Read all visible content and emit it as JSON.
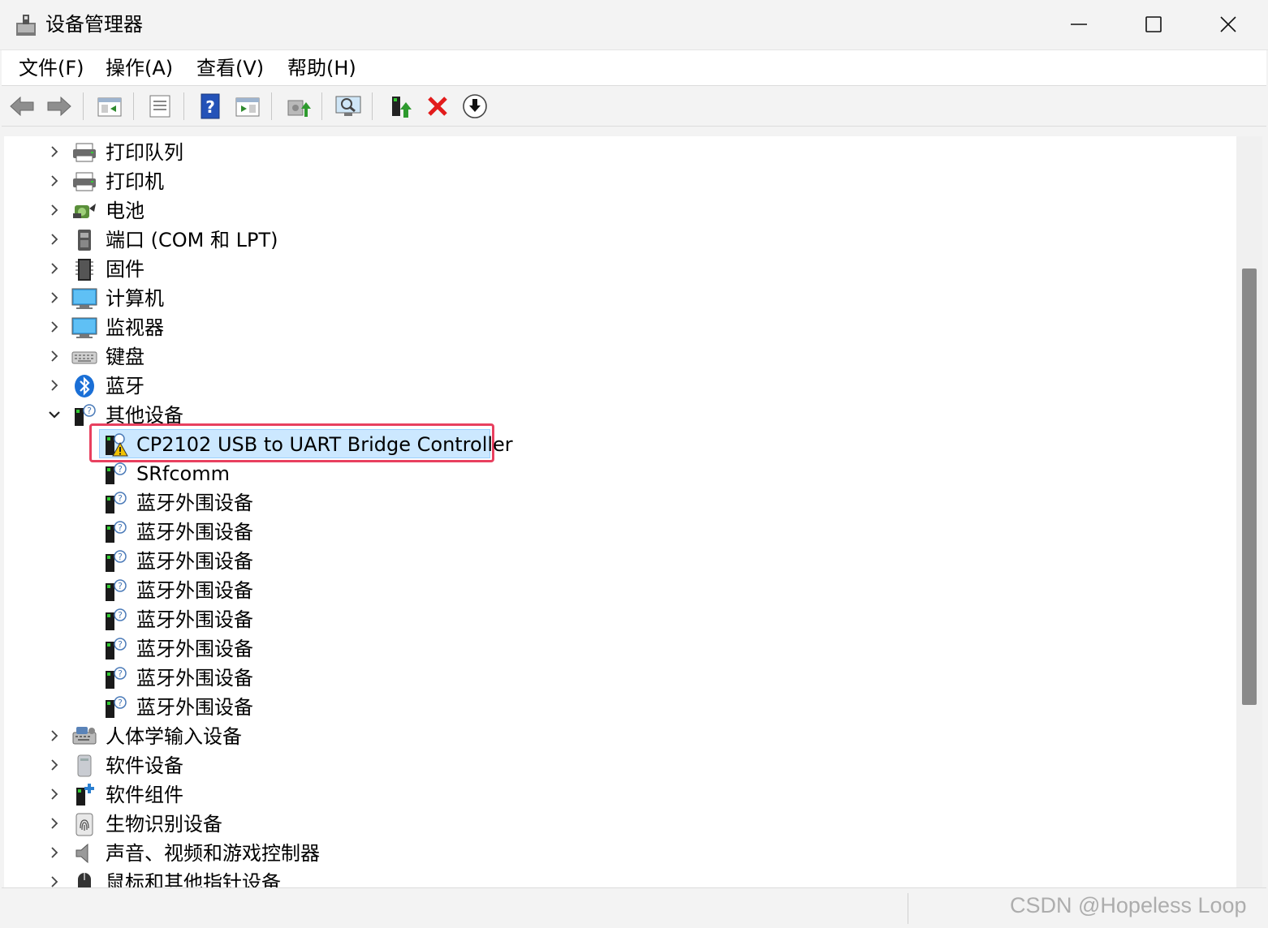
{
  "window": {
    "title": "设备管理器"
  },
  "menu": [
    "文件(F)",
    "操作(A)",
    "查看(V)",
    "帮助(H)"
  ],
  "toolbar": [
    "back",
    "forward",
    "show-hide-console-tree",
    "properties",
    "help",
    "action-pane",
    "update-driver",
    "scan-hardware",
    "enable-device",
    "uninstall-device",
    "download"
  ],
  "tree": {
    "categories_top": [
      {
        "label": "打印队列",
        "icon": "printer-queue-icon"
      },
      {
        "label": "打印机",
        "icon": "printer-icon"
      },
      {
        "label": "电池",
        "icon": "battery-icon"
      },
      {
        "label": "端口 (COM 和 LPT)",
        "icon": "port-icon"
      },
      {
        "label": "固件",
        "icon": "firmware-chip-icon"
      },
      {
        "label": "计算机",
        "icon": "computer-icon"
      },
      {
        "label": "监视器",
        "icon": "monitor-icon"
      },
      {
        "label": "键盘",
        "icon": "keyboard-icon"
      },
      {
        "label": "蓝牙",
        "icon": "bluetooth-icon"
      }
    ],
    "expanded": {
      "label": "其他设备",
      "icon": "unknown-device-icon",
      "children": [
        {
          "label": "CP2102 USB to UART Bridge Controller",
          "icon": "warning-device-icon",
          "selected": true,
          "highlighted": true
        },
        {
          "label": "SRfcomm",
          "icon": "unknown-device-icon"
        },
        {
          "label": "蓝牙外围设备",
          "icon": "unknown-device-icon"
        },
        {
          "label": "蓝牙外围设备",
          "icon": "unknown-device-icon"
        },
        {
          "label": "蓝牙外围设备",
          "icon": "unknown-device-icon"
        },
        {
          "label": "蓝牙外围设备",
          "icon": "unknown-device-icon"
        },
        {
          "label": "蓝牙外围设备",
          "icon": "unknown-device-icon"
        },
        {
          "label": "蓝牙外围设备",
          "icon": "unknown-device-icon"
        },
        {
          "label": "蓝牙外围设备",
          "icon": "unknown-device-icon"
        },
        {
          "label": "蓝牙外围设备",
          "icon": "unknown-device-icon"
        }
      ]
    },
    "categories_bottom": [
      {
        "label": "人体学输入设备",
        "icon": "hid-icon"
      },
      {
        "label": "软件设备",
        "icon": "software-device-icon"
      },
      {
        "label": "软件组件",
        "icon": "software-component-icon"
      },
      {
        "label": "生物识别设备",
        "icon": "biometric-icon"
      },
      {
        "label": "声音、视频和游戏控制器",
        "icon": "speaker-icon"
      },
      {
        "label": "鼠标和其他指针设备",
        "icon": "mouse-icon"
      }
    ]
  },
  "watermark": "CSDN @Hopeless Loop"
}
